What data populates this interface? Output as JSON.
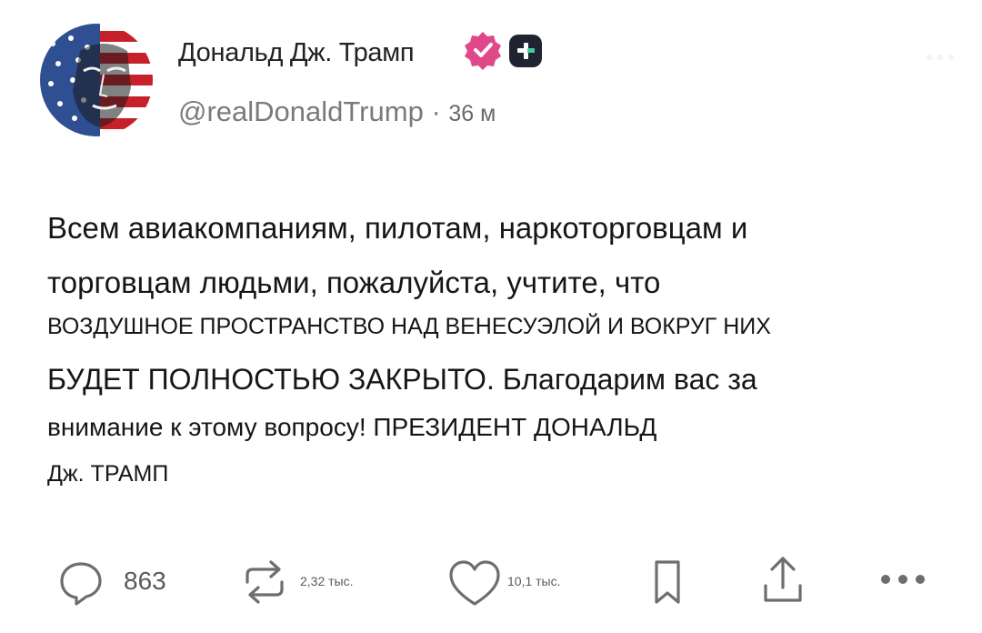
{
  "author": {
    "display_name": "Дональд Дж. Трамп",
    "handle": "@realDonaldTrump",
    "separator": "·",
    "time": "36 м",
    "verified_color": "#e0488a",
    "avatar_icon": "flag-portrait-avatar",
    "badge_icon": "plus-square-icon"
  },
  "post": {
    "lines": [
      "Всем авиакомпаниям, пилотам, наркоторговцам и",
      "торговцам людьми, пожалуйста, учтите, что",
      "ВОЗДУШНОЕ ПРОСТРАНСТВО НАД ВЕНЕСУЭЛОЙ И ВОКРУГ НИХ",
      "БУДЕТ ПОЛНОСТЬЮ ЗАКРЫТО. Благодарим вас за",
      "внимание к этому вопросу! ПРЕЗИДЕНТ ДОНАЛЬД",
      "Дж. ТРАМП"
    ]
  },
  "actions": {
    "replies": "863",
    "reposts": "2,32 тыс.",
    "likes": "10,1 тыс.",
    "icons": [
      "reply-icon",
      "repost-icon",
      "heart-icon",
      "bookmark-icon",
      "share-icon",
      "more-icon"
    ]
  }
}
